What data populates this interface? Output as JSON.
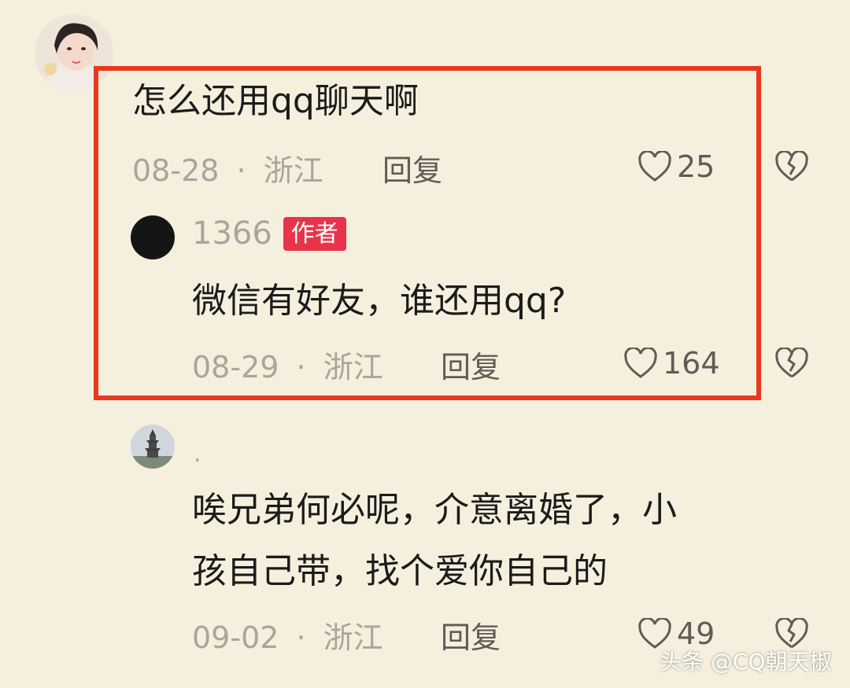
{
  "comments": [
    {
      "text": "怎么还用qq聊天啊",
      "date": "08-28",
      "location": "浙江",
      "reply_label": "回复",
      "likes": "25",
      "replies": [
        {
          "username": "1366",
          "badge": "作者",
          "text": "微信有好友，谁还用qq?",
          "date": "08-29",
          "location": "浙江",
          "reply_label": "回复",
          "likes": "164"
        }
      ]
    },
    {
      "username": ".",
      "text_line1": "唉兄弟何必呢，介意离婚了，小",
      "text_line2": "孩自己带，找个爱你自己的",
      "date": "09-02",
      "location": "浙江",
      "reply_label": "回复",
      "likes": "49"
    }
  ],
  "separator": "·",
  "watermark": "头条 @CQ朝天椒",
  "colors": {
    "highlight_border": "#e8381d",
    "badge_bg": "#e8344a",
    "background": "#f5efdd"
  },
  "icons": [
    "heart-outline-icon",
    "broken-heart-icon"
  ]
}
